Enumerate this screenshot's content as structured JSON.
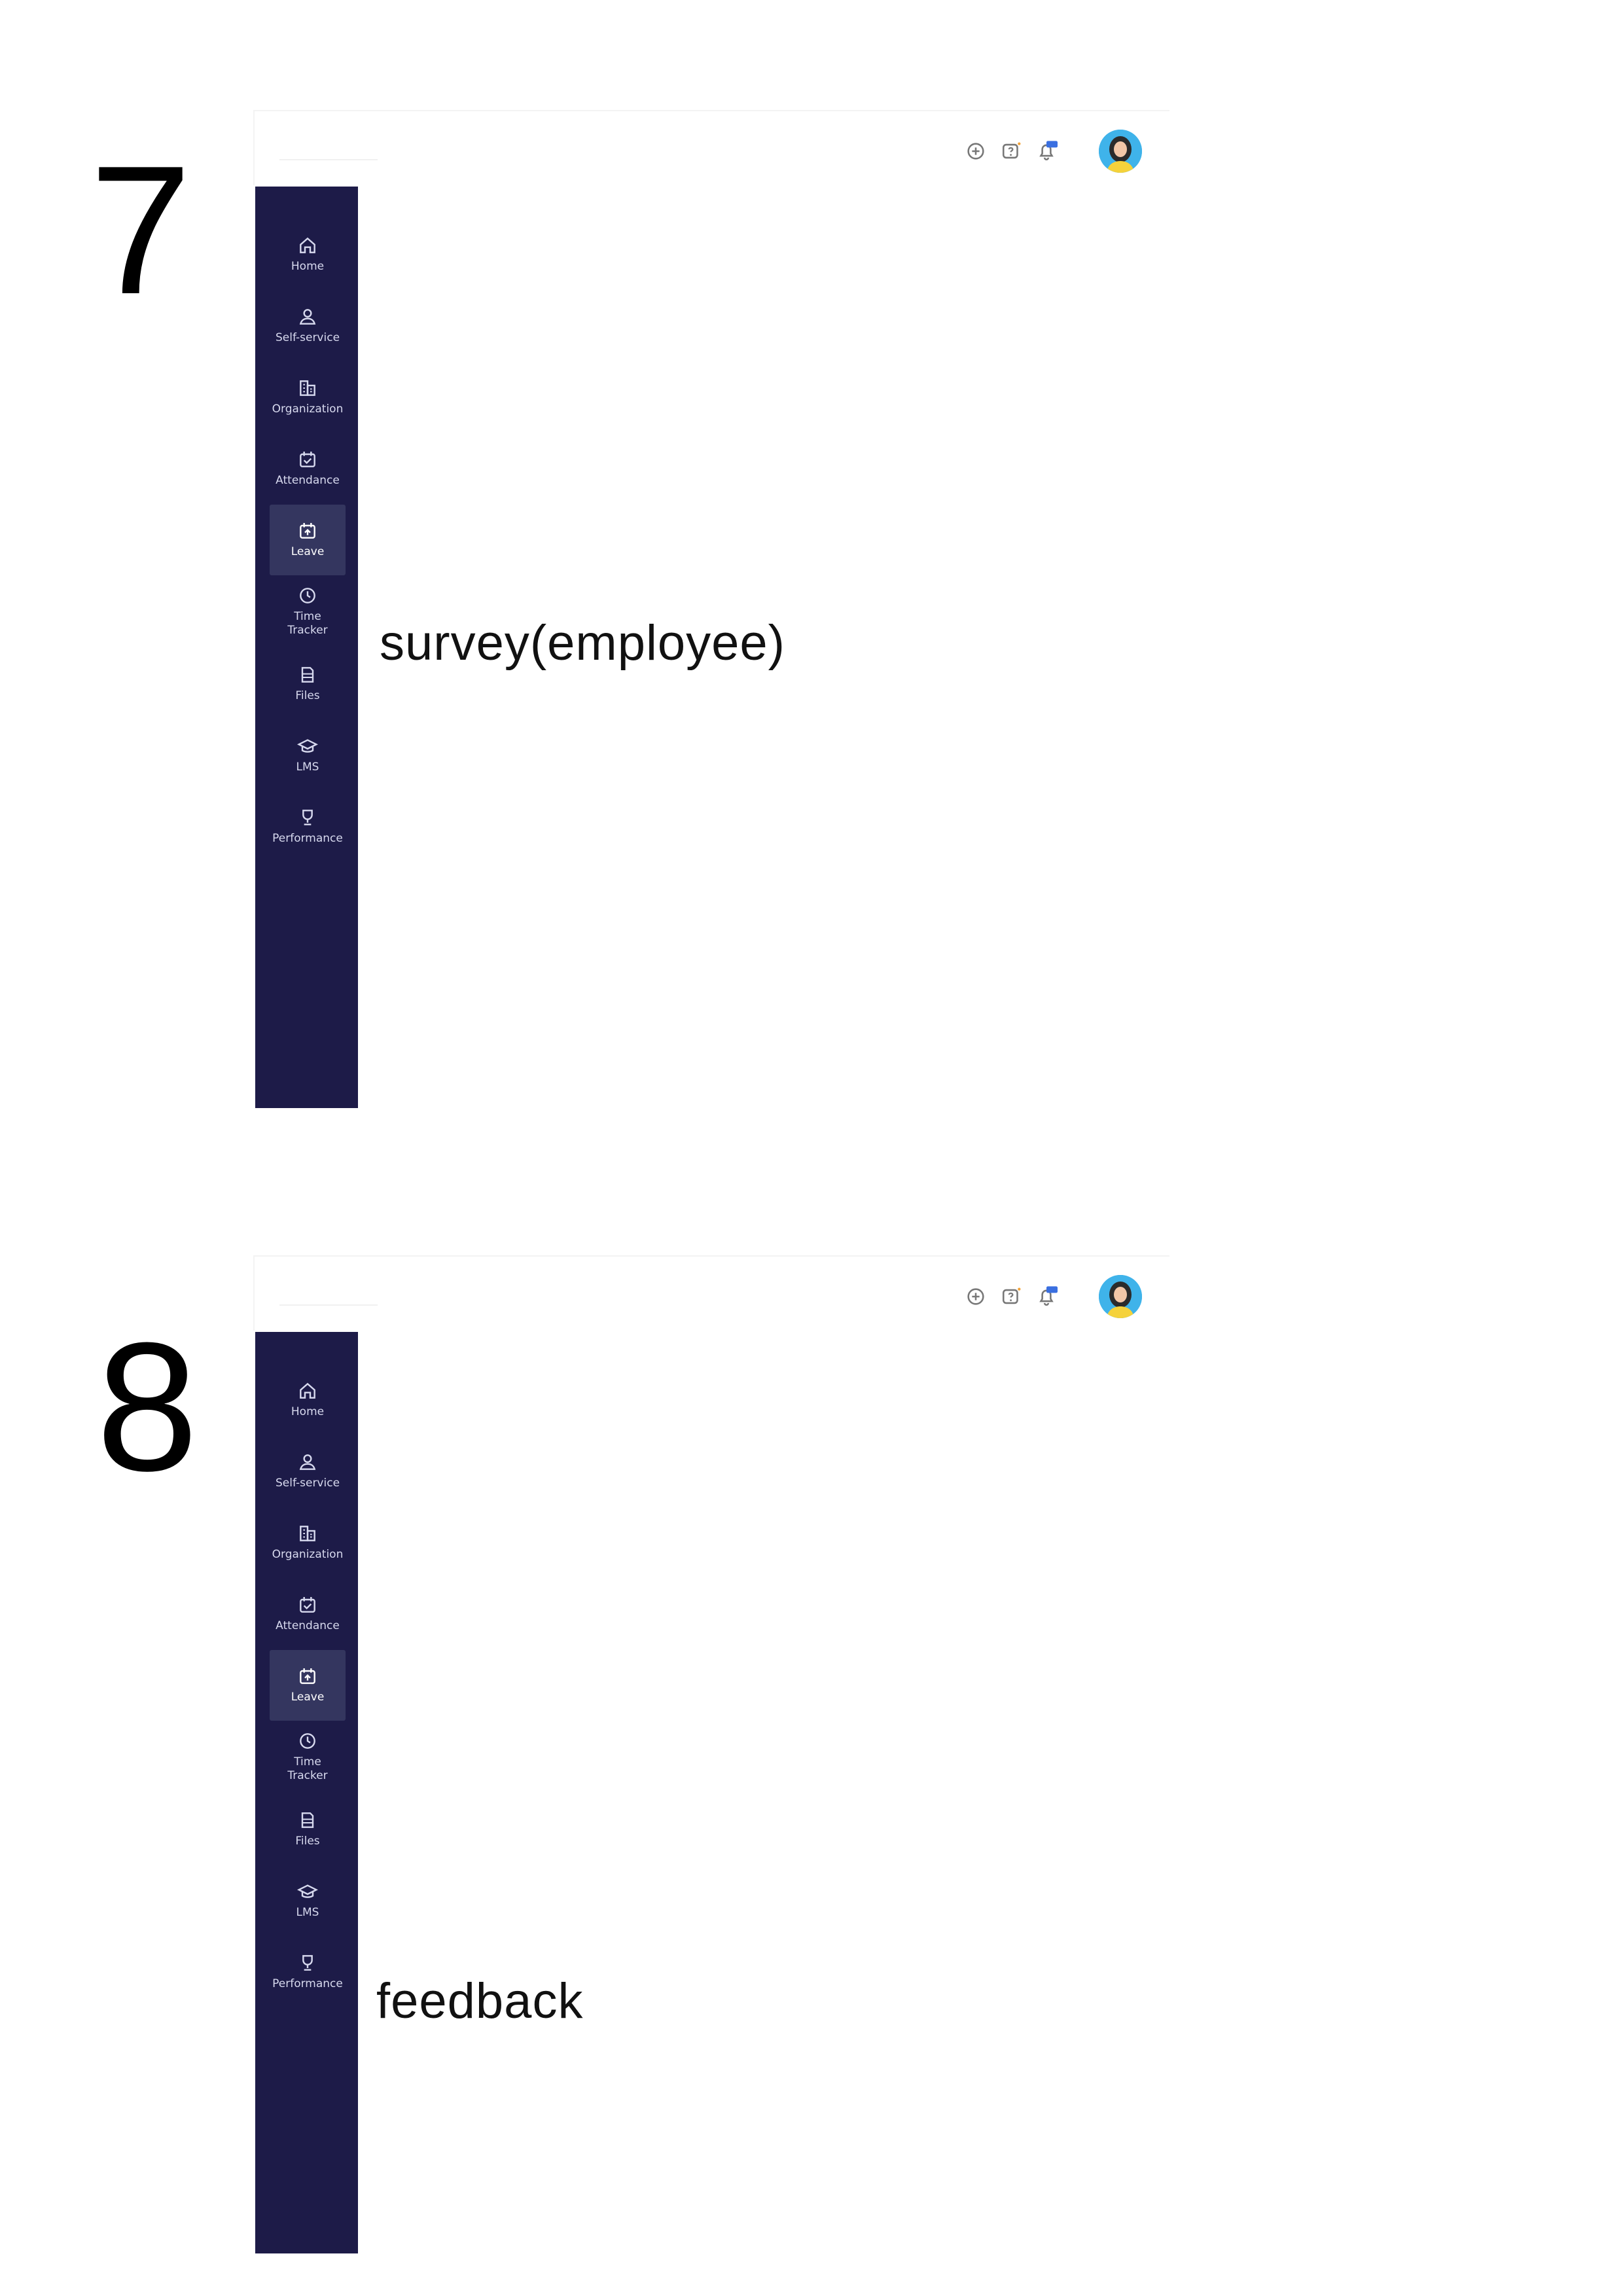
{
  "frames": [
    {
      "number": "7",
      "caption": "survey(employee)",
      "active_nav": "Leave"
    },
    {
      "number": "8",
      "caption": "feedback",
      "active_nav": "Leave"
    }
  ],
  "topbar": {
    "notification_badge": "99+",
    "icons": [
      "plus-circle-icon",
      "help-chat-icon",
      "bell-icon",
      "avatar"
    ]
  },
  "sidebar": {
    "items": [
      {
        "label": "Home",
        "icon": "home-icon"
      },
      {
        "label": "Self-service",
        "icon": "user-icon"
      },
      {
        "label": "Organization",
        "icon": "building-icon"
      },
      {
        "label": "Attendance",
        "icon": "calendar-check-icon"
      },
      {
        "label": "Leave",
        "icon": "calendar-leave-icon"
      },
      {
        "label": "Time\nTracker",
        "icon": "clock-icon"
      },
      {
        "label": "Files",
        "icon": "files-icon"
      },
      {
        "label": "LMS",
        "icon": "graduation-cap-icon"
      },
      {
        "label": "Performance",
        "icon": "trophy-icon"
      }
    ]
  },
  "colors": {
    "sidebar_bg": "#1d1b48",
    "sidebar_active_bg": "#34365f",
    "sidebar_text": "#d7d9ee",
    "badge_blue": "#3a6fe0",
    "avatar_bg": "#3fb3ea"
  }
}
